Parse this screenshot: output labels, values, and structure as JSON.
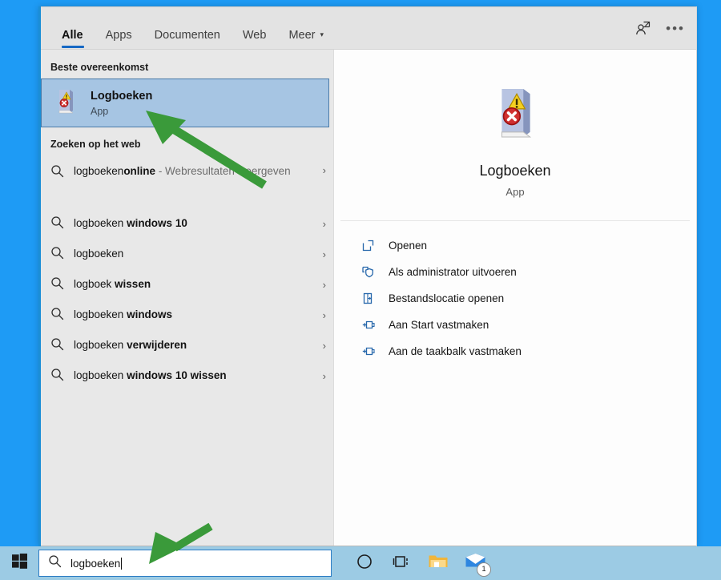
{
  "desktop": {
    "background_color": "#1e9bf5"
  },
  "search_panel": {
    "tabs": [
      {
        "label": "Alle",
        "active": true
      },
      {
        "label": "Apps",
        "active": false
      },
      {
        "label": "Documenten",
        "active": false
      },
      {
        "label": "Web",
        "active": false
      },
      {
        "label": "Meer",
        "active": false,
        "has_caret": true,
        "caret": "▾"
      }
    ],
    "header_icons": [
      {
        "name": "account-icon"
      },
      {
        "name": "more-options-icon",
        "glyph": "•••"
      }
    ],
    "best_match": {
      "section_label": "Beste overeenkomst",
      "title": "Logboeken",
      "subtitle": "App",
      "selected": true,
      "selection_bg": "#a6c5e3",
      "selection_border": "#4a7ba8",
      "icon": "event-viewer-icon"
    },
    "web_section": {
      "label": "Zoeken op het web",
      "items": [
        {
          "prefix": "logboeken",
          "bold": "online",
          "suffix": " - Webresultaten weergeven",
          "two_line": true
        },
        {
          "prefix": "logboeken ",
          "bold": "windows 10",
          "suffix": "",
          "two_line": false
        },
        {
          "prefix": "logboeken",
          "bold": "",
          "suffix": "",
          "two_line": false
        },
        {
          "prefix": "logboek ",
          "bold": "wissen",
          "suffix": "",
          "two_line": false
        },
        {
          "prefix": "logboeken ",
          "bold": "windows",
          "suffix": "",
          "two_line": false
        },
        {
          "prefix": "logboeken ",
          "bold": "verwijderen",
          "suffix": "",
          "two_line": false
        },
        {
          "prefix": "logboeken ",
          "bold": "windows 10 wissen",
          "suffix": "",
          "two_line": false
        }
      ],
      "chevron": "›"
    },
    "preview": {
      "app_title": "Logboeken",
      "app_type": "App",
      "icon": "event-viewer-icon",
      "actions": [
        {
          "label": "Openen",
          "icon": "open-window-icon"
        },
        {
          "label": "Als administrator uitvoeren",
          "icon": "shield-run-as-admin-icon"
        },
        {
          "label": "Bestandslocatie openen",
          "icon": "folder-location-icon"
        },
        {
          "label": "Aan Start vastmaken",
          "icon": "pin-icon"
        },
        {
          "label": "Aan de taakbalk vastmaken",
          "icon": "pin-icon"
        }
      ]
    }
  },
  "taskbar": {
    "background_color": "#9ccbe4",
    "start_button": {
      "name": "start-button",
      "icon": "windows-logo-icon"
    },
    "search": {
      "value": "logboeken",
      "icon": "search-icon",
      "border_color": "#2d7dc4"
    },
    "buttons": [
      {
        "name": "cortana-button",
        "icon": "cortana-circle-icon"
      },
      {
        "name": "task-view-button",
        "icon": "task-view-icon"
      },
      {
        "name": "file-explorer-button",
        "icon": "folder-icon"
      },
      {
        "name": "mail-button",
        "icon": "mail-icon",
        "badge": "1"
      }
    ]
  },
  "annotations": {
    "arrow_color": "#3a9a3a",
    "arrows": [
      {
        "name": "arrow-pointing-to-best-match",
        "direction": "up-left"
      },
      {
        "name": "arrow-pointing-to-search-box",
        "direction": "down-left"
      }
    ]
  }
}
